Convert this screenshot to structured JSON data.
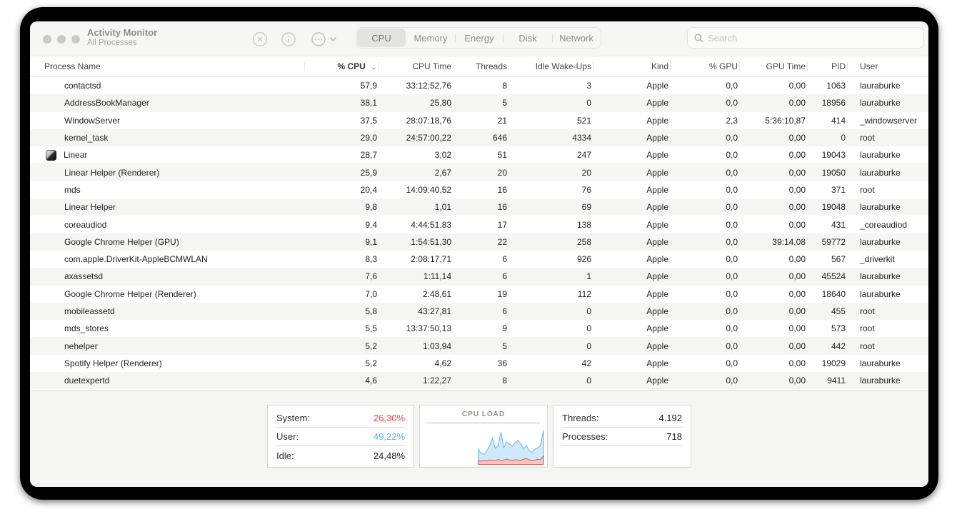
{
  "window": {
    "title": "Activity Monitor",
    "subtitle": "All Processes",
    "toolbar": {
      "quit_icon": "stop-octagon-x",
      "inspect_icon": "info-circle",
      "options_icon": "ellipsis-circle",
      "options_chevron": "chevron-down"
    },
    "tabs": [
      {
        "label": "CPU",
        "selected": true
      },
      {
        "label": "Memory",
        "selected": false
      },
      {
        "label": "Energy",
        "selected": false
      },
      {
        "label": "Disk",
        "selected": false
      },
      {
        "label": "Network",
        "selected": false
      }
    ],
    "search": {
      "placeholder": "Search",
      "icon": "magnifier"
    }
  },
  "table": {
    "columns": [
      "Process Name",
      "% CPU",
      "CPU Time",
      "Threads",
      "Idle Wake-Ups",
      "Kind",
      "% GPU",
      "GPU Time",
      "PID",
      "User"
    ],
    "sort_column": "% CPU",
    "sort_direction": "descending",
    "rows": [
      {
        "name": "contactsd",
        "has_icon": false,
        "cpu": "57,9",
        "cpu_time": "33:12:52,76",
        "threads": "8",
        "idle_wakeups": "3",
        "kind": "Apple",
        "gpu": "0,0",
        "gpu_time": "0,00",
        "pid": "1063",
        "user": "lauraburke"
      },
      {
        "name": "AddressBookManager",
        "has_icon": false,
        "cpu": "38,1",
        "cpu_time": "25,80",
        "threads": "5",
        "idle_wakeups": "0",
        "kind": "Apple",
        "gpu": "0,0",
        "gpu_time": "0,00",
        "pid": "18956",
        "user": "lauraburke"
      },
      {
        "name": "WindowServer",
        "has_icon": false,
        "cpu": "37,5",
        "cpu_time": "28:07:18,76",
        "threads": "21",
        "idle_wakeups": "521",
        "kind": "Apple",
        "gpu": "2,3",
        "gpu_time": "5:36:10,87",
        "pid": "414",
        "user": "_windowserver"
      },
      {
        "name": "kernel_task",
        "has_icon": false,
        "cpu": "29,0",
        "cpu_time": "24:57:00,22",
        "threads": "646",
        "idle_wakeups": "4334",
        "kind": "Apple",
        "gpu": "0,0",
        "gpu_time": "0,00",
        "pid": "0",
        "user": "root"
      },
      {
        "name": "Linear",
        "has_icon": true,
        "cpu": "28,7",
        "cpu_time": "3,02",
        "threads": "51",
        "idle_wakeups": "247",
        "kind": "Apple",
        "gpu": "0,0",
        "gpu_time": "0,00",
        "pid": "19043",
        "user": "lauraburke"
      },
      {
        "name": "Linear Helper (Renderer)",
        "has_icon": false,
        "cpu": "25,9",
        "cpu_time": "2,67",
        "threads": "20",
        "idle_wakeups": "20",
        "kind": "Apple",
        "gpu": "0,0",
        "gpu_time": "0,00",
        "pid": "19050",
        "user": "lauraburke"
      },
      {
        "name": "mds",
        "has_icon": false,
        "cpu": "20,4",
        "cpu_time": "14:09:40,52",
        "threads": "16",
        "idle_wakeups": "76",
        "kind": "Apple",
        "gpu": "0,0",
        "gpu_time": "0,00",
        "pid": "371",
        "user": "root"
      },
      {
        "name": "Linear Helper",
        "has_icon": false,
        "cpu": "9,8",
        "cpu_time": "1,01",
        "threads": "16",
        "idle_wakeups": "69",
        "kind": "Apple",
        "gpu": "0,0",
        "gpu_time": "0,00",
        "pid": "19048",
        "user": "lauraburke"
      },
      {
        "name": "coreaudiod",
        "has_icon": false,
        "cpu": "9,4",
        "cpu_time": "4:44:51,83",
        "threads": "17",
        "idle_wakeups": "138",
        "kind": "Apple",
        "gpu": "0,0",
        "gpu_time": "0,00",
        "pid": "431",
        "user": "_coreaudiod"
      },
      {
        "name": "Google Chrome Helper (GPU)",
        "has_icon": false,
        "cpu": "9,1",
        "cpu_time": "1:54:51,30",
        "threads": "22",
        "idle_wakeups": "258",
        "kind": "Apple",
        "gpu": "0,0",
        "gpu_time": "39:14,08",
        "pid": "59772",
        "user": "lauraburke"
      },
      {
        "name": "com.apple.DriverKit-AppleBCMWLAN",
        "has_icon": false,
        "cpu": "8,3",
        "cpu_time": "2:08:17,71",
        "threads": "6",
        "idle_wakeups": "926",
        "kind": "Apple",
        "gpu": "0,0",
        "gpu_time": "0,00",
        "pid": "567",
        "user": "_driverkit"
      },
      {
        "name": "axassetsd",
        "has_icon": false,
        "cpu": "7,6",
        "cpu_time": "1:11,14",
        "threads": "6",
        "idle_wakeups": "1",
        "kind": "Apple",
        "gpu": "0,0",
        "gpu_time": "0,00",
        "pid": "45524",
        "user": "lauraburke"
      },
      {
        "name": "Google Chrome Helper (Renderer)",
        "has_icon": false,
        "cpu": "7,0",
        "cpu_time": "2:48,61",
        "threads": "19",
        "idle_wakeups": "112",
        "kind": "Apple",
        "gpu": "0,0",
        "gpu_time": "0,00",
        "pid": "18640",
        "user": "lauraburke"
      },
      {
        "name": "mobileassetd",
        "has_icon": false,
        "cpu": "5,8",
        "cpu_time": "43:27,81",
        "threads": "6",
        "idle_wakeups": "0",
        "kind": "Apple",
        "gpu": "0,0",
        "gpu_time": "0,00",
        "pid": "455",
        "user": "root"
      },
      {
        "name": "mds_stores",
        "has_icon": false,
        "cpu": "5,5",
        "cpu_time": "13:37:50,13",
        "threads": "9",
        "idle_wakeups": "0",
        "kind": "Apple",
        "gpu": "0,0",
        "gpu_time": "0,00",
        "pid": "573",
        "user": "root"
      },
      {
        "name": "nehelper",
        "has_icon": false,
        "cpu": "5,2",
        "cpu_time": "1:03,94",
        "threads": "5",
        "idle_wakeups": "0",
        "kind": "Apple",
        "gpu": "0,0",
        "gpu_time": "0,00",
        "pid": "442",
        "user": "root"
      },
      {
        "name": "Spotify Helper (Renderer)",
        "has_icon": false,
        "cpu": "5,2",
        "cpu_time": "4,62",
        "threads": "36",
        "idle_wakeups": "42",
        "kind": "Apple",
        "gpu": "0,0",
        "gpu_time": "0,00",
        "pid": "19029",
        "user": "lauraburke"
      },
      {
        "name": "duetexpertd",
        "has_icon": false,
        "cpu": "4,6",
        "cpu_time": "1:22,27",
        "threads": "8",
        "idle_wakeups": "0",
        "kind": "Apple",
        "gpu": "0,0",
        "gpu_time": "0,00",
        "pid": "9411",
        "user": "lauraburke"
      }
    ]
  },
  "footer": {
    "cpu_summary": {
      "system_label": "System:",
      "system_value": "26,30%",
      "user_label": "User:",
      "user_value": "49,22%",
      "idle_label": "Idle:",
      "idle_value": "24,48%"
    },
    "counts": {
      "threads_label": "Threads:",
      "threads_value": "4.192",
      "processes_label": "Processes:",
      "processes_value": "718"
    },
    "colors": {
      "system": "#fb4a44",
      "user": "#56b6f2",
      "idle": "#1c1c1c"
    }
  },
  "chart_data": {
    "type": "area",
    "title": "CPU LOAD",
    "stacked": true,
    "ylim": [
      0,
      100
    ],
    "x_start_fraction": 0.45,
    "legend": "none",
    "series": [
      {
        "name": "system",
        "fill": "#f3c7c3",
        "stroke": "#e0564c",
        "values": [
          10,
          9,
          10,
          9,
          12,
          11,
          10,
          14,
          11,
          12,
          15,
          12,
          11,
          13,
          12,
          11,
          14,
          16,
          12,
          11,
          12,
          14,
          13,
          24
        ]
      },
      {
        "name": "user_total_stacked",
        "fill": "#cfe9fa",
        "stroke": "#6ab4e8",
        "values": [
          42,
          30,
          28,
          36,
          52,
          72,
          44,
          52,
          88,
          46,
          62,
          56,
          50,
          60,
          66,
          56,
          44,
          52,
          38,
          33,
          42,
          46,
          52,
          94
        ]
      }
    ]
  }
}
